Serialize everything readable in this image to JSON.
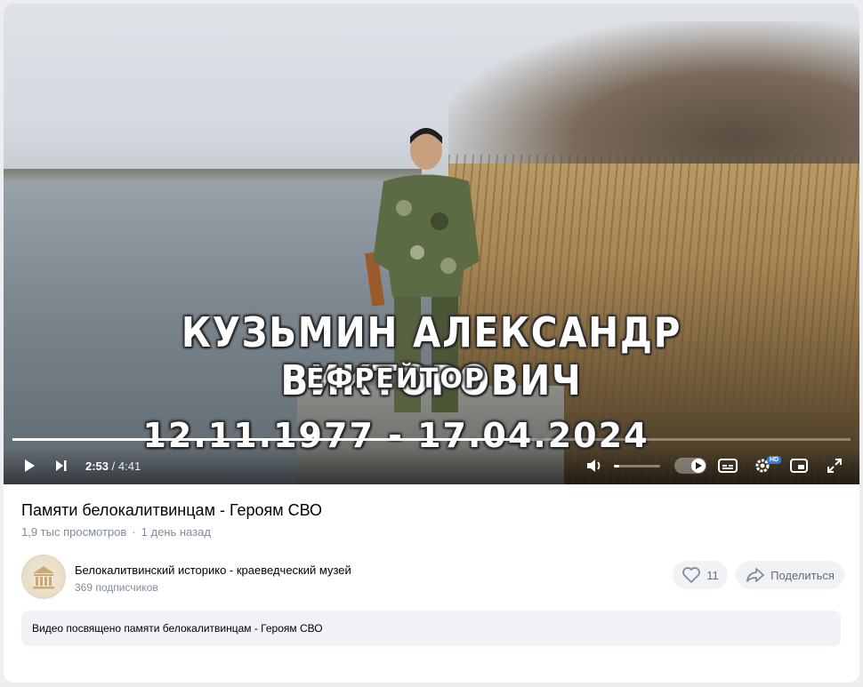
{
  "video": {
    "overlay": {
      "name": "КУЗЬМИН АЛЕКСАНДР ВИКТОРОВИЧ",
      "rank": "ЕФРЕЙТОР",
      "dates": "12.11.1977 - 17.04.2024"
    },
    "player": {
      "current_time": "2:53",
      "separator": " / ",
      "duration": "4:41",
      "progress_fraction": 0.615,
      "volume_fraction": 0.12,
      "quality_badge": "HD"
    },
    "icons": {
      "play": "play-icon",
      "next": "next-icon",
      "volume": "volume-icon",
      "autoplay": "autoplay-toggle",
      "subtitles": "subtitles-icon",
      "settings": "gear-icon",
      "pip": "picture-in-picture-icon",
      "fullscreen": "fullscreen-icon"
    }
  },
  "info": {
    "title": "Памяти белокалитвинцам - Героям СВО",
    "views": "1,9 тыс просмотров",
    "meta_separator": "·",
    "date": "1 день назад"
  },
  "channel": {
    "name": "Белокалитвинский историко - краеведческий музей",
    "subscribers": "369 подписчиков"
  },
  "actions": {
    "likes": "11",
    "share_label": "Поделиться"
  },
  "description": "Видео посвящено памяти белокалитвинцам - Героям СВО",
  "colors": {
    "accent": "#2d81e0",
    "muted_text": "#818c99",
    "button_bg": "#f0f2f5"
  }
}
